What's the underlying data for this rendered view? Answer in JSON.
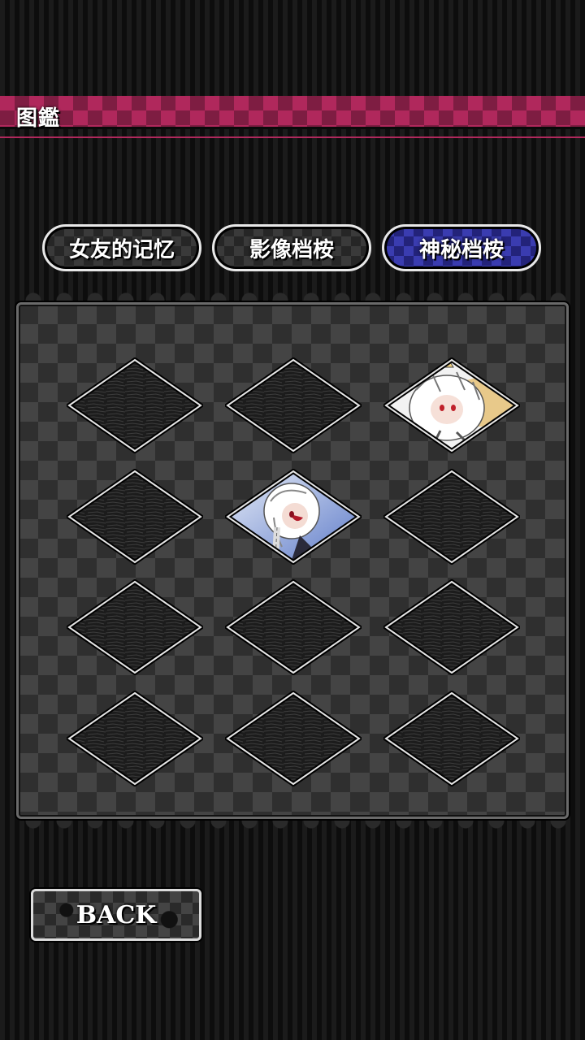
{
  "header": {
    "title": "图鑑"
  },
  "tabs": [
    {
      "label": "女友的记忆",
      "active": false
    },
    {
      "label": "影像档桉",
      "active": false
    },
    {
      "label": "神秘档桉",
      "active": true
    }
  ],
  "gallery": {
    "rows": [
      [
        {
          "unlocked": false
        },
        {
          "unlocked": false
        },
        {
          "unlocked": true,
          "portrait": "white-hair-horned-girl"
        }
      ],
      [
        {
          "unlocked": false
        },
        {
          "unlocked": true,
          "portrait": "white-hair-braid-girl"
        },
        {
          "unlocked": false
        }
      ],
      [
        {
          "unlocked": false
        },
        {
          "unlocked": false
        },
        {
          "unlocked": false
        }
      ],
      [
        {
          "unlocked": false
        },
        {
          "unlocked": false
        },
        {
          "unlocked": false
        }
      ]
    ]
  },
  "footer": {
    "back_label": "BACK"
  },
  "colors": {
    "header_accent": "#b0285c",
    "active_tab": "#3a3cb0",
    "tab_border": "#e8e8e8"
  }
}
